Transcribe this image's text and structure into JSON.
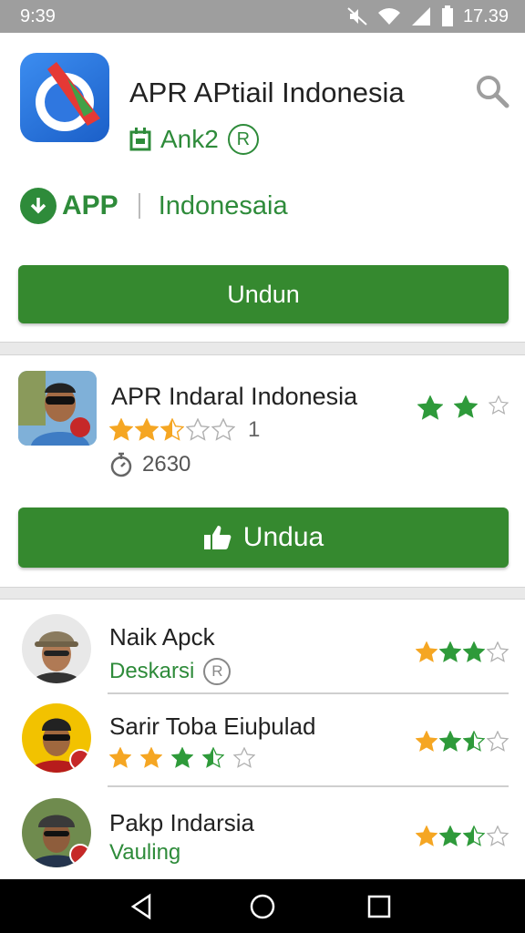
{
  "status_bar": {
    "time": "9:39",
    "clock": "17.39",
    "icons": [
      "mute-icon",
      "wifi-icon",
      "signal-icon",
      "battery-icon"
    ]
  },
  "header": {
    "app_title": "APR APtiail Indonesia",
    "developer": "Ank2",
    "developer_badge": "R",
    "app_label": "APP",
    "region": "Indonesaia",
    "install_label": "Undun",
    "icons": [
      "app-logo-icon",
      "search-icon",
      "calendar-icon",
      "download-circle-icon"
    ]
  },
  "featured": {
    "title": "APR Indaral Indonesia",
    "rating": "1",
    "count": "2630",
    "stars_filled": 2.5,
    "side_stars_filled": 2,
    "download_label": "Undua",
    "icons": [
      "timer-icon",
      "thumbs-up-icon"
    ]
  },
  "list": [
    {
      "name": "Naik Apck",
      "sub": "Deskarsi",
      "sub_badge": "R",
      "stars": 3
    },
    {
      "name": "Sarir Toba Eiuþulad",
      "stars_inline": 3.5,
      "stars": 2.5
    },
    {
      "name": "Pakp Indarsia",
      "sub": "Vauling",
      "stars": 2.5
    }
  ],
  "nav": {
    "icons": [
      "back-icon",
      "home-icon",
      "recents-icon"
    ]
  },
  "colors": {
    "accent_green": "#35892f",
    "text_green": "#2e8b3a",
    "star_orange": "#f5a623",
    "star_green": "#2e9a3a"
  }
}
